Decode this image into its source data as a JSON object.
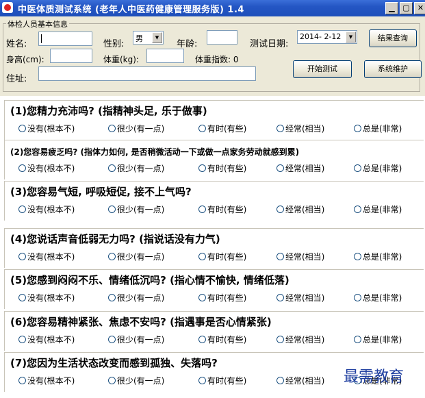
{
  "window": {
    "title": "中医体质测试系统 (老年人中医药健康管理服务版) 1.4",
    "controls": [
      "minimize-icon",
      "restore-icon",
      "close-icon"
    ]
  },
  "info": {
    "group_label": "体检人员基本信息",
    "name_label": "姓名:",
    "name_value": "",
    "gender_label": "性别:",
    "gender_value": "男",
    "age_label": "年龄:",
    "age_value": "",
    "date_label": "测试日期:",
    "date_value": "2014- 2-12",
    "result_button": "结果查询",
    "height_label": "身高(cm):",
    "height_value": "",
    "weight_label": "体重(kg):",
    "weight_value": "",
    "bmi_label": "体重指数: 0",
    "start_button": "开始测试",
    "address_label": "住址:",
    "address_value": "",
    "maintain_button": "系统维护"
  },
  "options": [
    "没有(根本不)",
    "很少(有一点)",
    "有时(有些)",
    "经常(相当)",
    "总是(非常)"
  ],
  "questions": [
    {
      "title": "(1)您精力充沛吗? (指精神头足, 乐于做事)"
    },
    {
      "title": "(2)您容易疲乏吗? (指体力如何, 是否稍微活动一下或做一点家务劳动就感到累)"
    },
    {
      "title": "(3)您容易气短, 呼吸短促, 接不上气吗?"
    },
    {
      "title": "(4)您说话声音低弱无力吗? (指说话没有力气)"
    },
    {
      "title": "(5)您感到闷闷不乐、情绪低沉吗? (指心情不愉快, 情绪低落)"
    },
    {
      "title": "(6)您容易精神紧张、焦虑不安吗? (指遇事是否心情紧张)"
    },
    {
      "title": "(7)您因为生活状态改变而感到孤独、失落吗?"
    }
  ],
  "watermark": "最需教育",
  "colors": {
    "titlebar": "#2456c4",
    "panel": "#ece9d8",
    "watermark": "#1f3fa0"
  }
}
